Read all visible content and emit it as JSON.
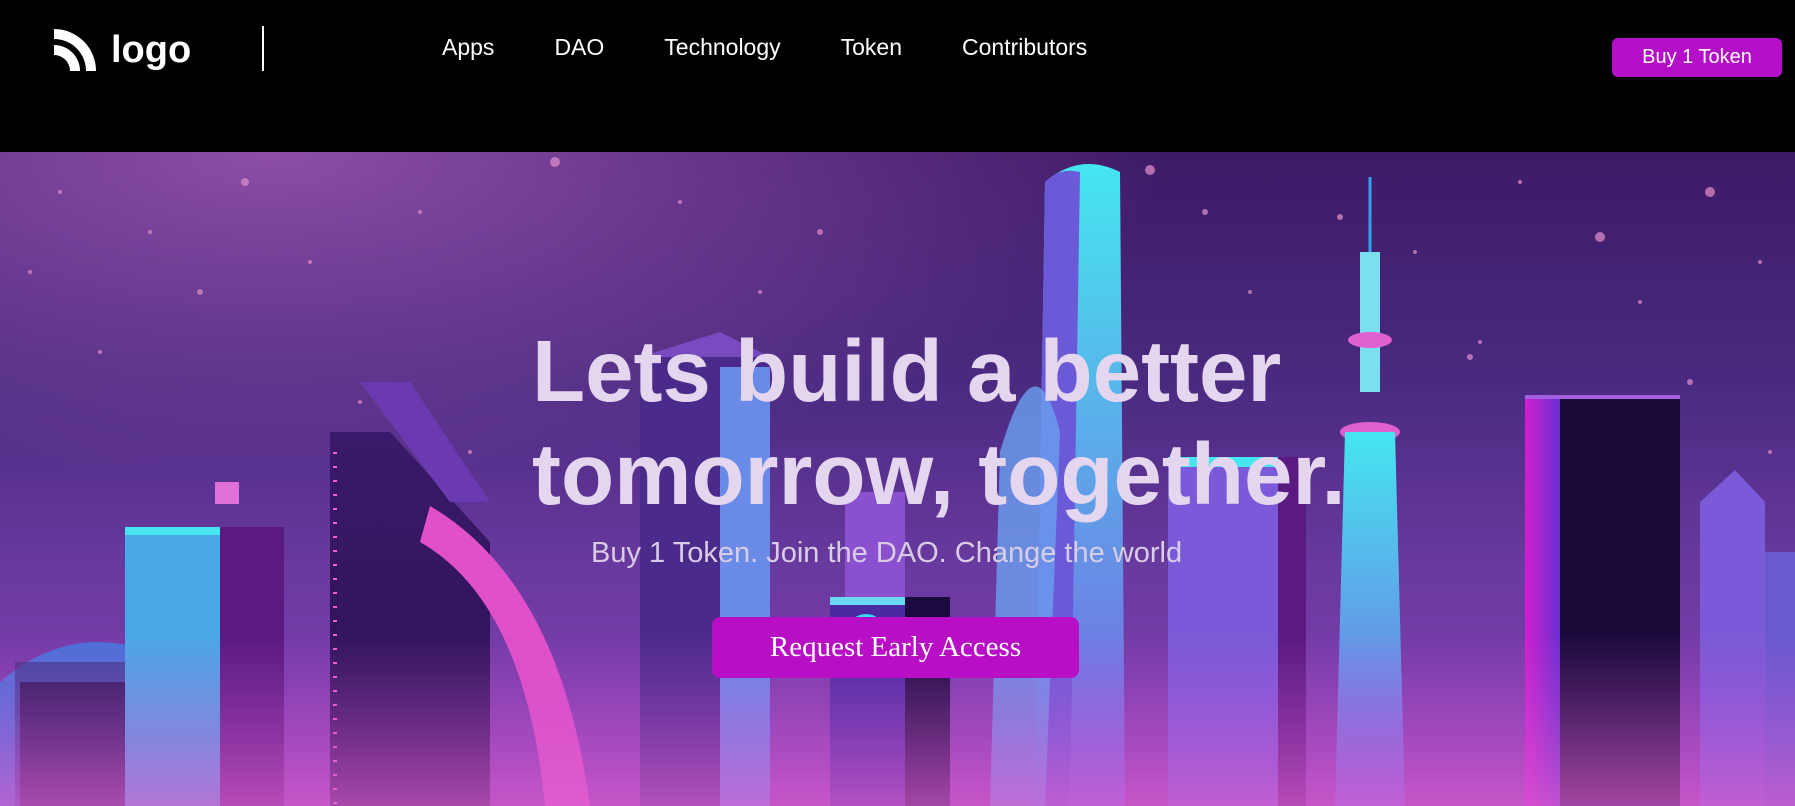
{
  "header": {
    "logo_text": "logo",
    "logo_icon": "rss-feed-icon",
    "nav": [
      {
        "label": "Apps"
      },
      {
        "label": "DAO"
      },
      {
        "label": "Technology"
      },
      {
        "label": "Token"
      },
      {
        "label": "Contributors"
      }
    ],
    "buy_button": "Buy 1 Token"
  },
  "hero": {
    "title_line1": "Lets build a better",
    "title_line2": "tomorrow, together.",
    "subtitle": "Buy 1 Token. Join the DAO. Change the world",
    "cta": "Request Early Access",
    "background": "neon-city-skyline-illustration"
  },
  "colors": {
    "accent": "#b50ec8",
    "header_bg": "#000000",
    "hero_text": "#e3d6ee"
  }
}
